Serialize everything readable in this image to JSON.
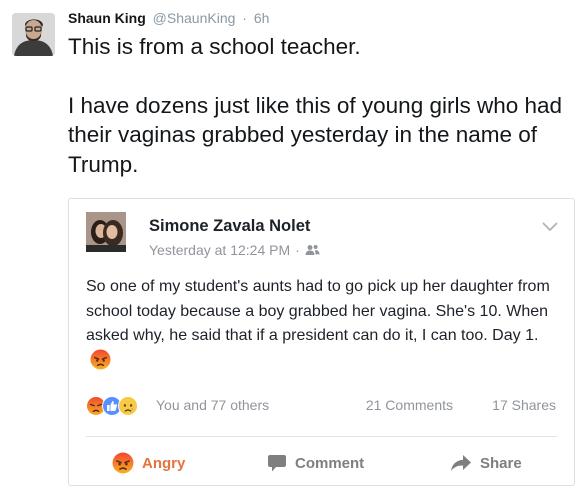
{
  "tweet": {
    "author_name": "Shaun King",
    "author_handle": "@ShaunKing",
    "separator": "·",
    "time": "6h",
    "paragraphs": [
      "This is from a school teacher.",
      "I have dozens just like this of young girls who had their vaginas grabbed yesterday in the name of Trump."
    ]
  },
  "fb_post": {
    "author_name": "Simone Zavala Nolet",
    "timestamp": "Yesterday at 12:24 PM",
    "separator": "·",
    "audience_icon": "friends-icon",
    "text": "So one of my student's aunts had to go pick up her daughter from school today because a boy grabbed her vagina. She's 10. When asked why, he said that if a president can do it, I can too. Day 1.",
    "reactions_summary": "You and 77 others",
    "comments_count": "21 Comments",
    "shares_count": "17 Shares",
    "actions": {
      "angry": "Angry",
      "comment": "Comment",
      "share": "Share"
    },
    "colors": {
      "angry": "#e5743e",
      "like_blue": "#5890ff",
      "muted": "#90949c"
    }
  }
}
